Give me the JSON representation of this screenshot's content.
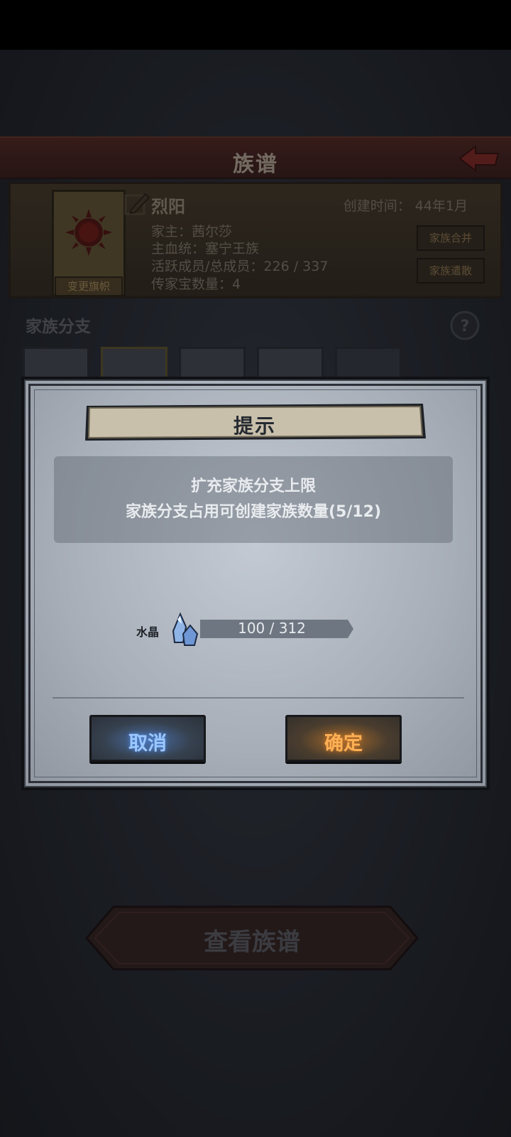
{
  "page": {
    "title": "族谱",
    "view_button": "查看族谱"
  },
  "family": {
    "name": "烈阳",
    "created": "创建时间： 44年1月",
    "head": "家主：茜尔莎",
    "bloodline": "主血统：塞宁王族",
    "members": "活跃成员/总成员：226 / 337",
    "heirlooms": "传家宝数量：4",
    "change_banner": "变更旗帜",
    "merge_button": "家族合并",
    "disband_button": "家族遣散"
  },
  "branches": {
    "label": "家族分支"
  },
  "dialog": {
    "title": "提示",
    "message_line1": "扩充家族分支上限",
    "message_line2": "家族分支占用可创建家族数量(5/12)",
    "cost_label": "水晶",
    "cost_value": "100 / 312",
    "cancel": "取消",
    "confirm": "确定"
  },
  "colors": {
    "cancel_glow": "#4e8ae0",
    "confirm_glow": "#c7772a",
    "title_bar": "#5a2a22"
  }
}
